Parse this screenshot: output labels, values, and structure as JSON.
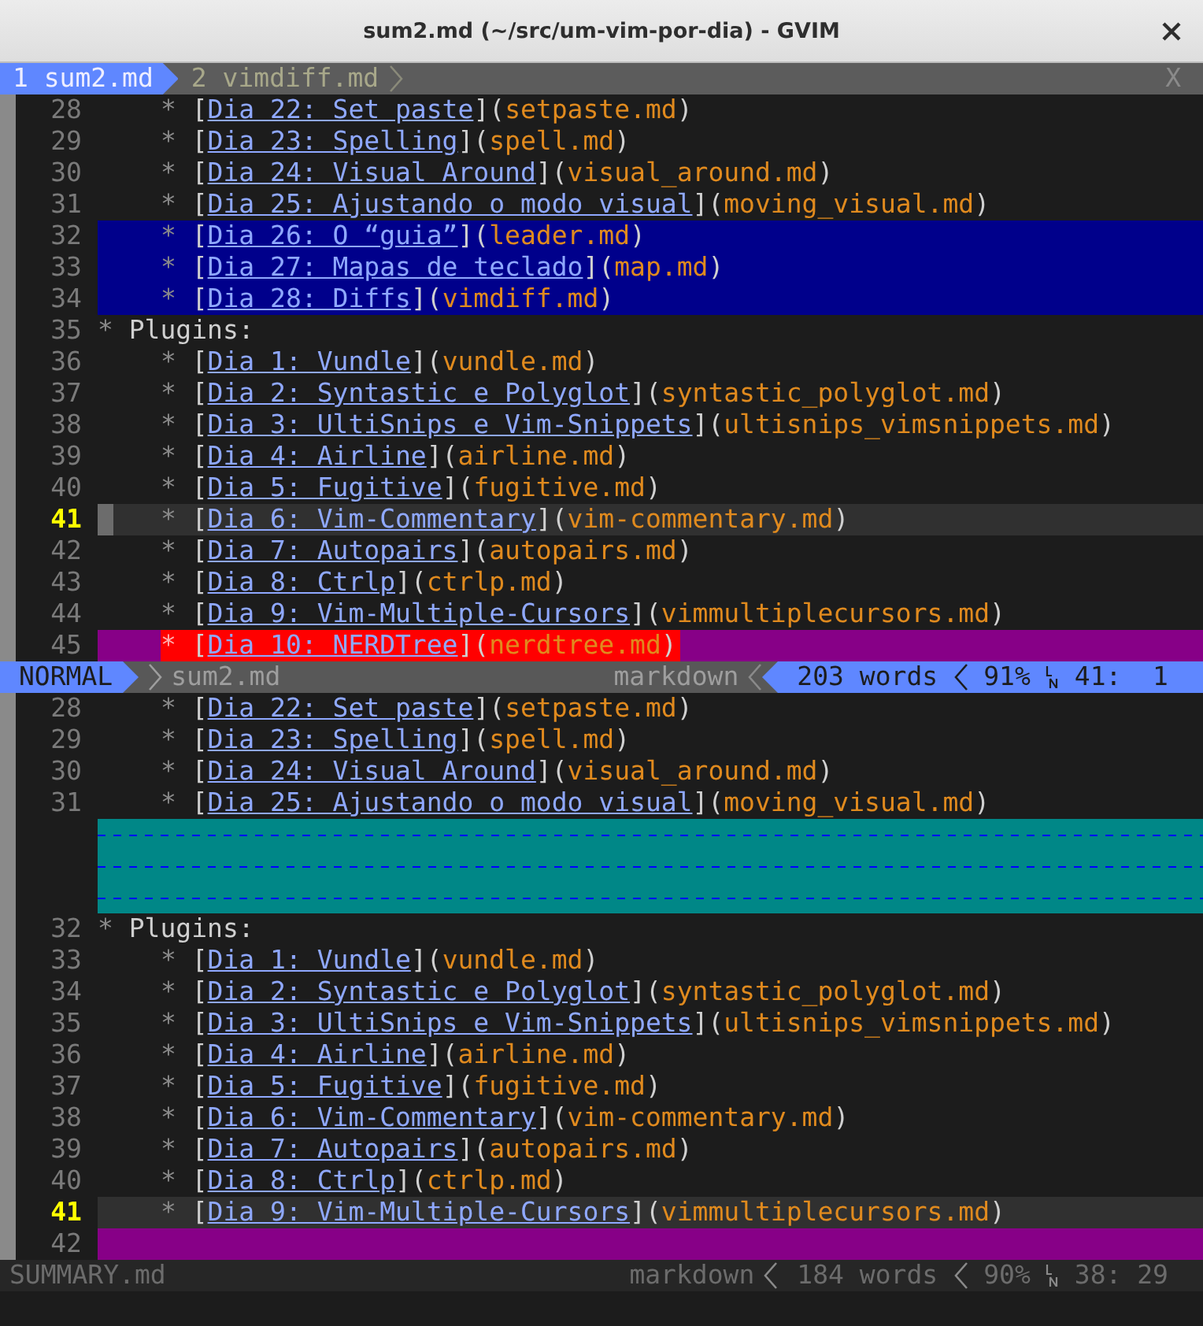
{
  "window": {
    "title": "sum2.md (~/src/um-vim-por-dia) - GVIM"
  },
  "tabs": [
    {
      "label": "1 sum2.md",
      "selected": true
    },
    {
      "label": "2 vimdiff.md",
      "selected": false
    }
  ],
  "tab_close": "X",
  "panes": [
    {
      "lines": [
        {
          "number": "28",
          "kind": "normal",
          "parts": [
            {
              "text": "*",
              "kind": "sub-bullet"
            },
            {
              "text": "[",
              "kind": "bracket"
            },
            {
              "text": "Dia 22: Set paste",
              "kind": "link"
            },
            {
              "text": "](",
              "kind": "bracket"
            },
            {
              "text": "setpaste.md",
              "kind": "file"
            },
            {
              "text": ")",
              "kind": "bracket"
            }
          ]
        },
        {
          "number": "29",
          "kind": "normal",
          "parts": [
            {
              "text": "*",
              "kind": "sub-bullet"
            },
            {
              "text": "[",
              "kind": "bracket"
            },
            {
              "text": "Dia 23: Spelling",
              "kind": "link"
            },
            {
              "text": "](",
              "kind": "bracket"
            },
            {
              "text": "spell.md",
              "kind": "file"
            },
            {
              "text": ")",
              "kind": "bracket"
            }
          ]
        },
        {
          "number": "30",
          "kind": "normal",
          "parts": [
            {
              "text": "*",
              "kind": "sub-bullet"
            },
            {
              "text": "[",
              "kind": "bracket"
            },
            {
              "text": "Dia 24: Visual Around",
              "kind": "link"
            },
            {
              "text": "](",
              "kind": "bracket"
            },
            {
              "text": "visual_around.md",
              "kind": "file"
            },
            {
              "text": ")",
              "kind": "bracket"
            }
          ]
        },
        {
          "number": "31",
          "kind": "normal",
          "parts": [
            {
              "text": "*",
              "kind": "sub-bullet"
            },
            {
              "text": "[",
              "kind": "bracket"
            },
            {
              "text": "Dia 25: Ajustando o modo visual",
              "kind": "link"
            },
            {
              "text": "](",
              "kind": "bracket"
            },
            {
              "text": "moving_visual.md",
              "kind": "file"
            },
            {
              "text": ")",
              "kind": "bracket"
            }
          ]
        },
        {
          "number": "32",
          "kind": "selected",
          "parts": [
            {
              "text": "*",
              "kind": "sub-bullet"
            },
            {
              "text": "[",
              "kind": "bracket"
            },
            {
              "text": "Dia 26: O “guia”",
              "kind": "link"
            },
            {
              "text": "](",
              "kind": "bracket"
            },
            {
              "text": "leader.md",
              "kind": "file"
            },
            {
              "text": ")",
              "kind": "bracket"
            }
          ]
        },
        {
          "number": "33",
          "kind": "selected",
          "parts": [
            {
              "text": "*",
              "kind": "sub-bullet"
            },
            {
              "text": "[",
              "kind": "bracket"
            },
            {
              "text": "Dia 27: Mapas de teclado",
              "kind": "link"
            },
            {
              "text": "](",
              "kind": "bracket"
            },
            {
              "text": "map.md",
              "kind": "file"
            },
            {
              "text": ")",
              "kind": "bracket"
            }
          ]
        },
        {
          "number": "34",
          "kind": "selected",
          "parts": [
            {
              "text": "*",
              "kind": "sub-bullet"
            },
            {
              "text": "[",
              "kind": "bracket"
            },
            {
              "text": "Dia 28: Diffs",
              "kind": "link"
            },
            {
              "text": "](",
              "kind": "bracket"
            },
            {
              "text": "vimdiff.md",
              "kind": "file"
            },
            {
              "text": ")",
              "kind": "bracket"
            }
          ]
        },
        {
          "number": "35",
          "kind": "normal",
          "parts": [
            {
              "text": "*",
              "kind": "bullet"
            },
            {
              "text": "Plugins:",
              "kind": "text"
            }
          ]
        },
        {
          "number": "36",
          "kind": "normal",
          "parts": [
            {
              "text": "*",
              "kind": "sub-bullet"
            },
            {
              "text": "[",
              "kind": "bracket"
            },
            {
              "text": "Dia 1: Vundle",
              "kind": "link"
            },
            {
              "text": "](",
              "kind": "bracket"
            },
            {
              "text": "vundle.md",
              "kind": "file"
            },
            {
              "text": ")",
              "kind": "bracket"
            }
          ]
        },
        {
          "number": "37",
          "kind": "normal",
          "parts": [
            {
              "text": "*",
              "kind": "sub-bullet"
            },
            {
              "text": "[",
              "kind": "bracket"
            },
            {
              "text": "Dia 2: Syntastic e Polyglot",
              "kind": "link"
            },
            {
              "text": "](",
              "kind": "bracket"
            },
            {
              "text": "syntastic_polyglot.md",
              "kind": "file"
            },
            {
              "text": ")",
              "kind": "bracket"
            }
          ]
        },
        {
          "number": "38",
          "kind": "normal",
          "parts": [
            {
              "text": "*",
              "kind": "sub-bullet"
            },
            {
              "text": "[",
              "kind": "bracket"
            },
            {
              "text": "Dia 3: UltiSnips e Vim-Snippets",
              "kind": "link"
            },
            {
              "text": "](",
              "kind": "bracket"
            },
            {
              "text": "ultisnips_vimsnippets.md",
              "kind": "file"
            },
            {
              "text": ")",
              "kind": "bracket"
            }
          ]
        },
        {
          "number": "39",
          "kind": "normal",
          "parts": [
            {
              "text": "*",
              "kind": "sub-bullet"
            },
            {
              "text": "[",
              "kind": "bracket"
            },
            {
              "text": "Dia 4: Airline",
              "kind": "link"
            },
            {
              "text": "](",
              "kind": "bracket"
            },
            {
              "text": "airline.md",
              "kind": "file"
            },
            {
              "text": ")",
              "kind": "bracket"
            }
          ]
        },
        {
          "number": "40",
          "kind": "normal",
          "parts": [
            {
              "text": "*",
              "kind": "sub-bullet"
            },
            {
              "text": "[",
              "kind": "bracket"
            },
            {
              "text": "Dia 5: Fugitive",
              "kind": "link"
            },
            {
              "text": "](",
              "kind": "bracket"
            },
            {
              "text": "fugitive.md",
              "kind": "file"
            },
            {
              "text": ")",
              "kind": "bracket"
            }
          ]
        },
        {
          "number": "41",
          "kind": "current",
          "parts": [
            {
              "text": "*",
              "kind": "sub-bullet"
            },
            {
              "text": "[",
              "kind": "bracket"
            },
            {
              "text": "Dia 6: Vim-Commentary",
              "kind": "link"
            },
            {
              "text": "](",
              "kind": "bracket"
            },
            {
              "text": "vim-commentary.md",
              "kind": "file"
            },
            {
              "text": ")",
              "kind": "bracket"
            }
          ]
        },
        {
          "number": "42",
          "kind": "normal",
          "parts": [
            {
              "text": "*",
              "kind": "sub-bullet"
            },
            {
              "text": "[",
              "kind": "bracket"
            },
            {
              "text": "Dia 7: Autopairs",
              "kind": "link"
            },
            {
              "text": "](",
              "kind": "bracket"
            },
            {
              "text": "autopairs.md",
              "kind": "file"
            },
            {
              "text": ")",
              "kind": "bracket"
            }
          ]
        },
        {
          "number": "43",
          "kind": "normal",
          "parts": [
            {
              "text": "*",
              "kind": "sub-bullet"
            },
            {
              "text": "[",
              "kind": "bracket"
            },
            {
              "text": "Dia 8: Ctrlp",
              "kind": "link"
            },
            {
              "text": "](",
              "kind": "bracket"
            },
            {
              "text": "ctrlp.md",
              "kind": "file"
            },
            {
              "text": ")",
              "kind": "bracket"
            }
          ]
        },
        {
          "number": "44",
          "kind": "normal",
          "parts": [
            {
              "text": "*",
              "kind": "sub-bullet"
            },
            {
              "text": "[",
              "kind": "bracket"
            },
            {
              "text": "Dia 9: Vim-Multiple-Cursors",
              "kind": "link"
            },
            {
              "text": "](",
              "kind": "bracket"
            },
            {
              "text": "vimmultiplecursors.md",
              "kind": "file"
            },
            {
              "text": ")",
              "kind": "bracket"
            }
          ]
        },
        {
          "number": "45",
          "kind": "changed",
          "parts": [
            {
              "text": "*",
              "kind": "sub-bullet"
            },
            {
              "text": "[",
              "kind": "bracket"
            },
            {
              "text": "Dia 10: NERDTree",
              "kind": "link"
            },
            {
              "text": "](",
              "kind": "bracket"
            },
            {
              "text": "nerdtree.md",
              "kind": "file"
            },
            {
              "text": ")",
              "kind": "bracket"
            }
          ]
        }
      ],
      "status": {
        "mode": "NORMAL",
        "file": "sum2.md",
        "filetype": "markdown",
        "words": "203 words",
        "percent": "91%",
        "position": "41:  1",
        "active": true
      }
    },
    {
      "lines": [
        {
          "number": "28",
          "kind": "normal",
          "parts": [
            {
              "text": "*",
              "kind": "sub-bullet"
            },
            {
              "text": "[",
              "kind": "bracket"
            },
            {
              "text": "Dia 22: Set paste",
              "kind": "link"
            },
            {
              "text": "](",
              "kind": "bracket"
            },
            {
              "text": "setpaste.md",
              "kind": "file"
            },
            {
              "text": ")",
              "kind": "bracket"
            }
          ]
        },
        {
          "number": "29",
          "kind": "normal",
          "parts": [
            {
              "text": "*",
              "kind": "sub-bullet"
            },
            {
              "text": "[",
              "kind": "bracket"
            },
            {
              "text": "Dia 23: Spelling",
              "kind": "link"
            },
            {
              "text": "](",
              "kind": "bracket"
            },
            {
              "text": "spell.md",
              "kind": "file"
            },
            {
              "text": ")",
              "kind": "bracket"
            }
          ]
        },
        {
          "number": "30",
          "kind": "normal",
          "parts": [
            {
              "text": "*",
              "kind": "sub-bullet"
            },
            {
              "text": "[",
              "kind": "bracket"
            },
            {
              "text": "Dia 24: Visual Around",
              "kind": "link"
            },
            {
              "text": "](",
              "kind": "bracket"
            },
            {
              "text": "visual_around.md",
              "kind": "file"
            },
            {
              "text": ")",
              "kind": "bracket"
            }
          ]
        },
        {
          "number": "31",
          "kind": "normal",
          "parts": [
            {
              "text": "*",
              "kind": "sub-bullet"
            },
            {
              "text": "[",
              "kind": "bracket"
            },
            {
              "text": "Dia 25: Ajustando o modo visual",
              "kind": "link"
            },
            {
              "text": "](",
              "kind": "bracket"
            },
            {
              "text": "moving_visual.md",
              "kind": "file"
            },
            {
              "text": ")",
              "kind": "bracket"
            }
          ]
        },
        {
          "kind": "filler"
        },
        {
          "kind": "filler"
        },
        {
          "kind": "filler"
        },
        {
          "number": "32",
          "kind": "normal",
          "parts": [
            {
              "text": "*",
              "kind": "bullet"
            },
            {
              "text": "Plugins:",
              "kind": "text"
            }
          ]
        },
        {
          "number": "33",
          "kind": "normal",
          "parts": [
            {
              "text": "*",
              "kind": "sub-bullet"
            },
            {
              "text": "[",
              "kind": "bracket"
            },
            {
              "text": "Dia 1: Vundle",
              "kind": "link"
            },
            {
              "text": "](",
              "kind": "bracket"
            },
            {
              "text": "vundle.md",
              "kind": "file"
            },
            {
              "text": ")",
              "kind": "bracket"
            }
          ]
        },
        {
          "number": "34",
          "kind": "normal",
          "parts": [
            {
              "text": "*",
              "kind": "sub-bullet"
            },
            {
              "text": "[",
              "kind": "bracket"
            },
            {
              "text": "Dia 2: Syntastic e Polyglot",
              "kind": "link"
            },
            {
              "text": "](",
              "kind": "bracket"
            },
            {
              "text": "syntastic_polyglot.md",
              "kind": "file"
            },
            {
              "text": ")",
              "kind": "bracket"
            }
          ]
        },
        {
          "number": "35",
          "kind": "normal",
          "parts": [
            {
              "text": "*",
              "kind": "sub-bullet"
            },
            {
              "text": "[",
              "kind": "bracket"
            },
            {
              "text": "Dia 3: UltiSnips e Vim-Snippets",
              "kind": "link"
            },
            {
              "text": "](",
              "kind": "bracket"
            },
            {
              "text": "ultisnips_vimsnippets.md",
              "kind": "file"
            },
            {
              "text": ")",
              "kind": "bracket"
            }
          ]
        },
        {
          "number": "36",
          "kind": "normal",
          "parts": [
            {
              "text": "*",
              "kind": "sub-bullet"
            },
            {
              "text": "[",
              "kind": "bracket"
            },
            {
              "text": "Dia 4: Airline",
              "kind": "link"
            },
            {
              "text": "](",
              "kind": "bracket"
            },
            {
              "text": "airline.md",
              "kind": "file"
            },
            {
              "text": ")",
              "kind": "bracket"
            }
          ]
        },
        {
          "number": "37",
          "kind": "normal",
          "parts": [
            {
              "text": "*",
              "kind": "sub-bullet"
            },
            {
              "text": "[",
              "kind": "bracket"
            },
            {
              "text": "Dia 5: Fugitive",
              "kind": "link"
            },
            {
              "text": "](",
              "kind": "bracket"
            },
            {
              "text": "fugitive.md",
              "kind": "file"
            },
            {
              "text": ")",
              "kind": "bracket"
            }
          ]
        },
        {
          "number": "38",
          "kind": "normal",
          "parts": [
            {
              "text": "*",
              "kind": "sub-bullet"
            },
            {
              "text": "[",
              "kind": "bracket"
            },
            {
              "text": "Dia 6: Vim-Commentary",
              "kind": "link"
            },
            {
              "text": "](",
              "kind": "bracket"
            },
            {
              "text": "vim-commentary.md",
              "kind": "file"
            },
            {
              "text": ")",
              "kind": "bracket"
            }
          ]
        },
        {
          "number": "39",
          "kind": "normal",
          "parts": [
            {
              "text": "*",
              "kind": "sub-bullet"
            },
            {
              "text": "[",
              "kind": "bracket"
            },
            {
              "text": "Dia 7: Autopairs",
              "kind": "link"
            },
            {
              "text": "](",
              "kind": "bracket"
            },
            {
              "text": "autopairs.md",
              "kind": "file"
            },
            {
              "text": ")",
              "kind": "bracket"
            }
          ]
        },
        {
          "number": "40",
          "kind": "normal",
          "parts": [
            {
              "text": "*",
              "kind": "sub-bullet"
            },
            {
              "text": "[",
              "kind": "bracket"
            },
            {
              "text": "Dia 8: Ctrlp",
              "kind": "link"
            },
            {
              "text": "](",
              "kind": "bracket"
            },
            {
              "text": "ctrlp.md",
              "kind": "file"
            },
            {
              "text": ")",
              "kind": "bracket"
            }
          ]
        },
        {
          "number": "41",
          "kind": "current",
          "parts": [
            {
              "text": "*",
              "kind": "sub-bullet"
            },
            {
              "text": "[",
              "kind": "bracket"
            },
            {
              "text": "Dia 9: Vim-Multiple-Cursors",
              "kind": "link"
            },
            {
              "text": "](",
              "kind": "bracket"
            },
            {
              "text": "vimmultiplecursors.md",
              "kind": "file"
            },
            {
              "text": ")",
              "kind": "bracket"
            }
          ]
        },
        {
          "number": "42",
          "kind": "added"
        }
      ],
      "status": {
        "file": "SUMMARY.md",
        "filetype": "markdown",
        "words": "184 words",
        "percent": "90%",
        "position": "38: 29",
        "active": false
      }
    }
  ]
}
